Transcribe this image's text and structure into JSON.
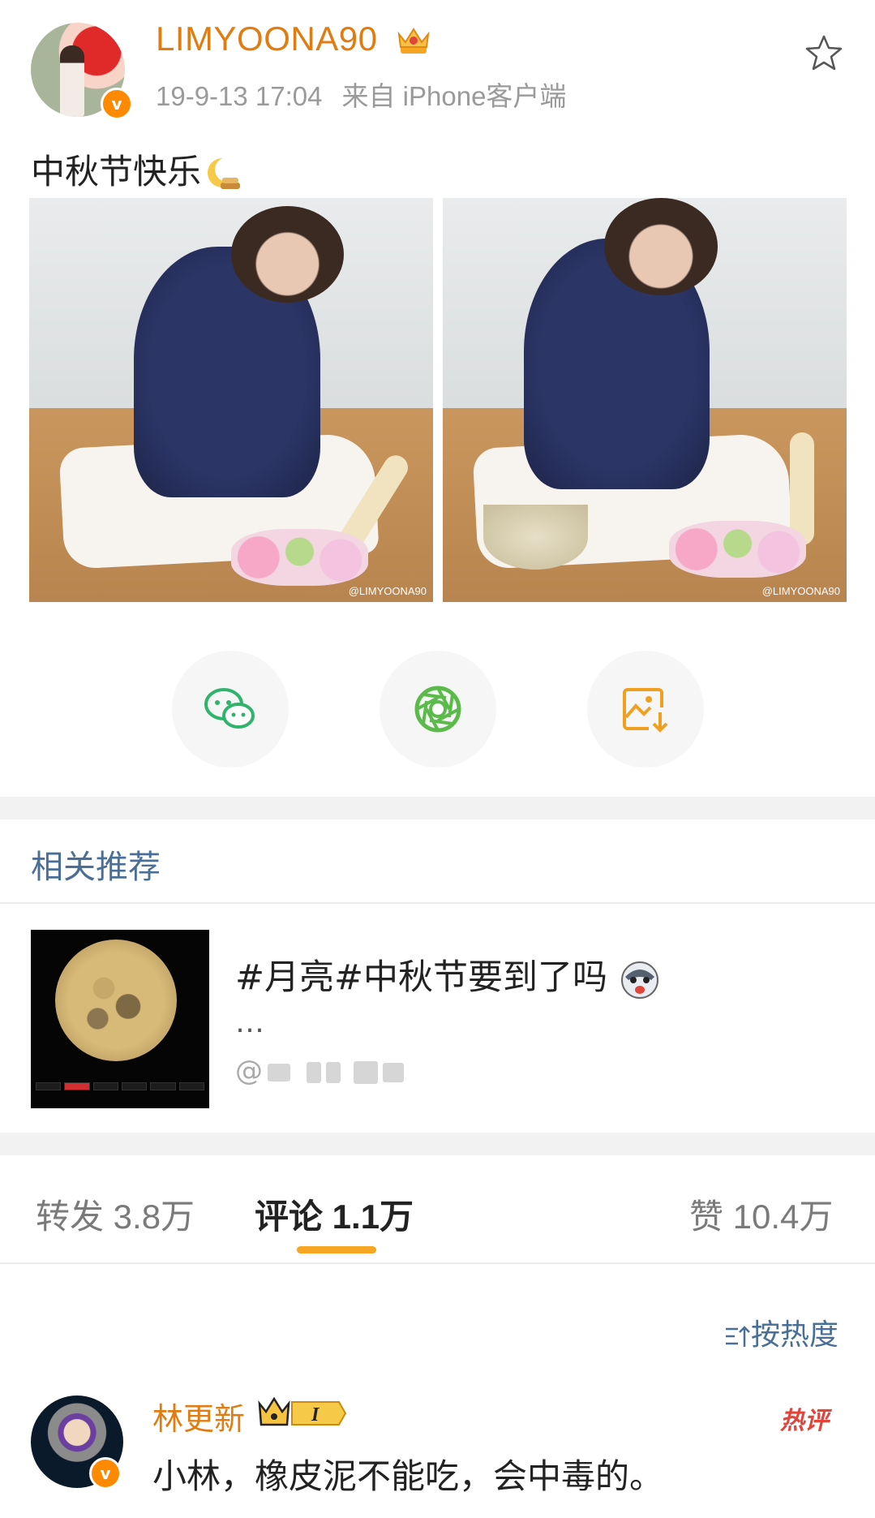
{
  "post": {
    "username": "LIMYOONA90",
    "date": "19-9-13 17:04",
    "source": "来自 iPhone客户端",
    "text": "中秋节快乐",
    "photo_watermarks": [
      "@LIMYOONA90",
      "@LIMYOONA90"
    ]
  },
  "share": {
    "buttons": [
      "wechat-icon",
      "moments-icon",
      "save-image-icon"
    ]
  },
  "related": {
    "title": "相关推荐",
    "item": {
      "text": "#月亮#中秋节要到了吗",
      "ellipsis": "…",
      "at": "@"
    }
  },
  "tabs": {
    "repost": "转发 3.8万",
    "comments": "评论 1.1万",
    "likes": "赞 10.4万"
  },
  "sort_label": "按热度",
  "comment": {
    "name": "林更新",
    "badge": "I",
    "hot_label": "热评",
    "text": "小林，橡皮泥不能吃，会中毒的。"
  },
  "colors": {
    "username": "#e07d12",
    "link_blue": "#4a6f97",
    "tab_underline": "#f5a623",
    "hot_red": "#e0443a",
    "verified_orange": "#ff8a00"
  }
}
